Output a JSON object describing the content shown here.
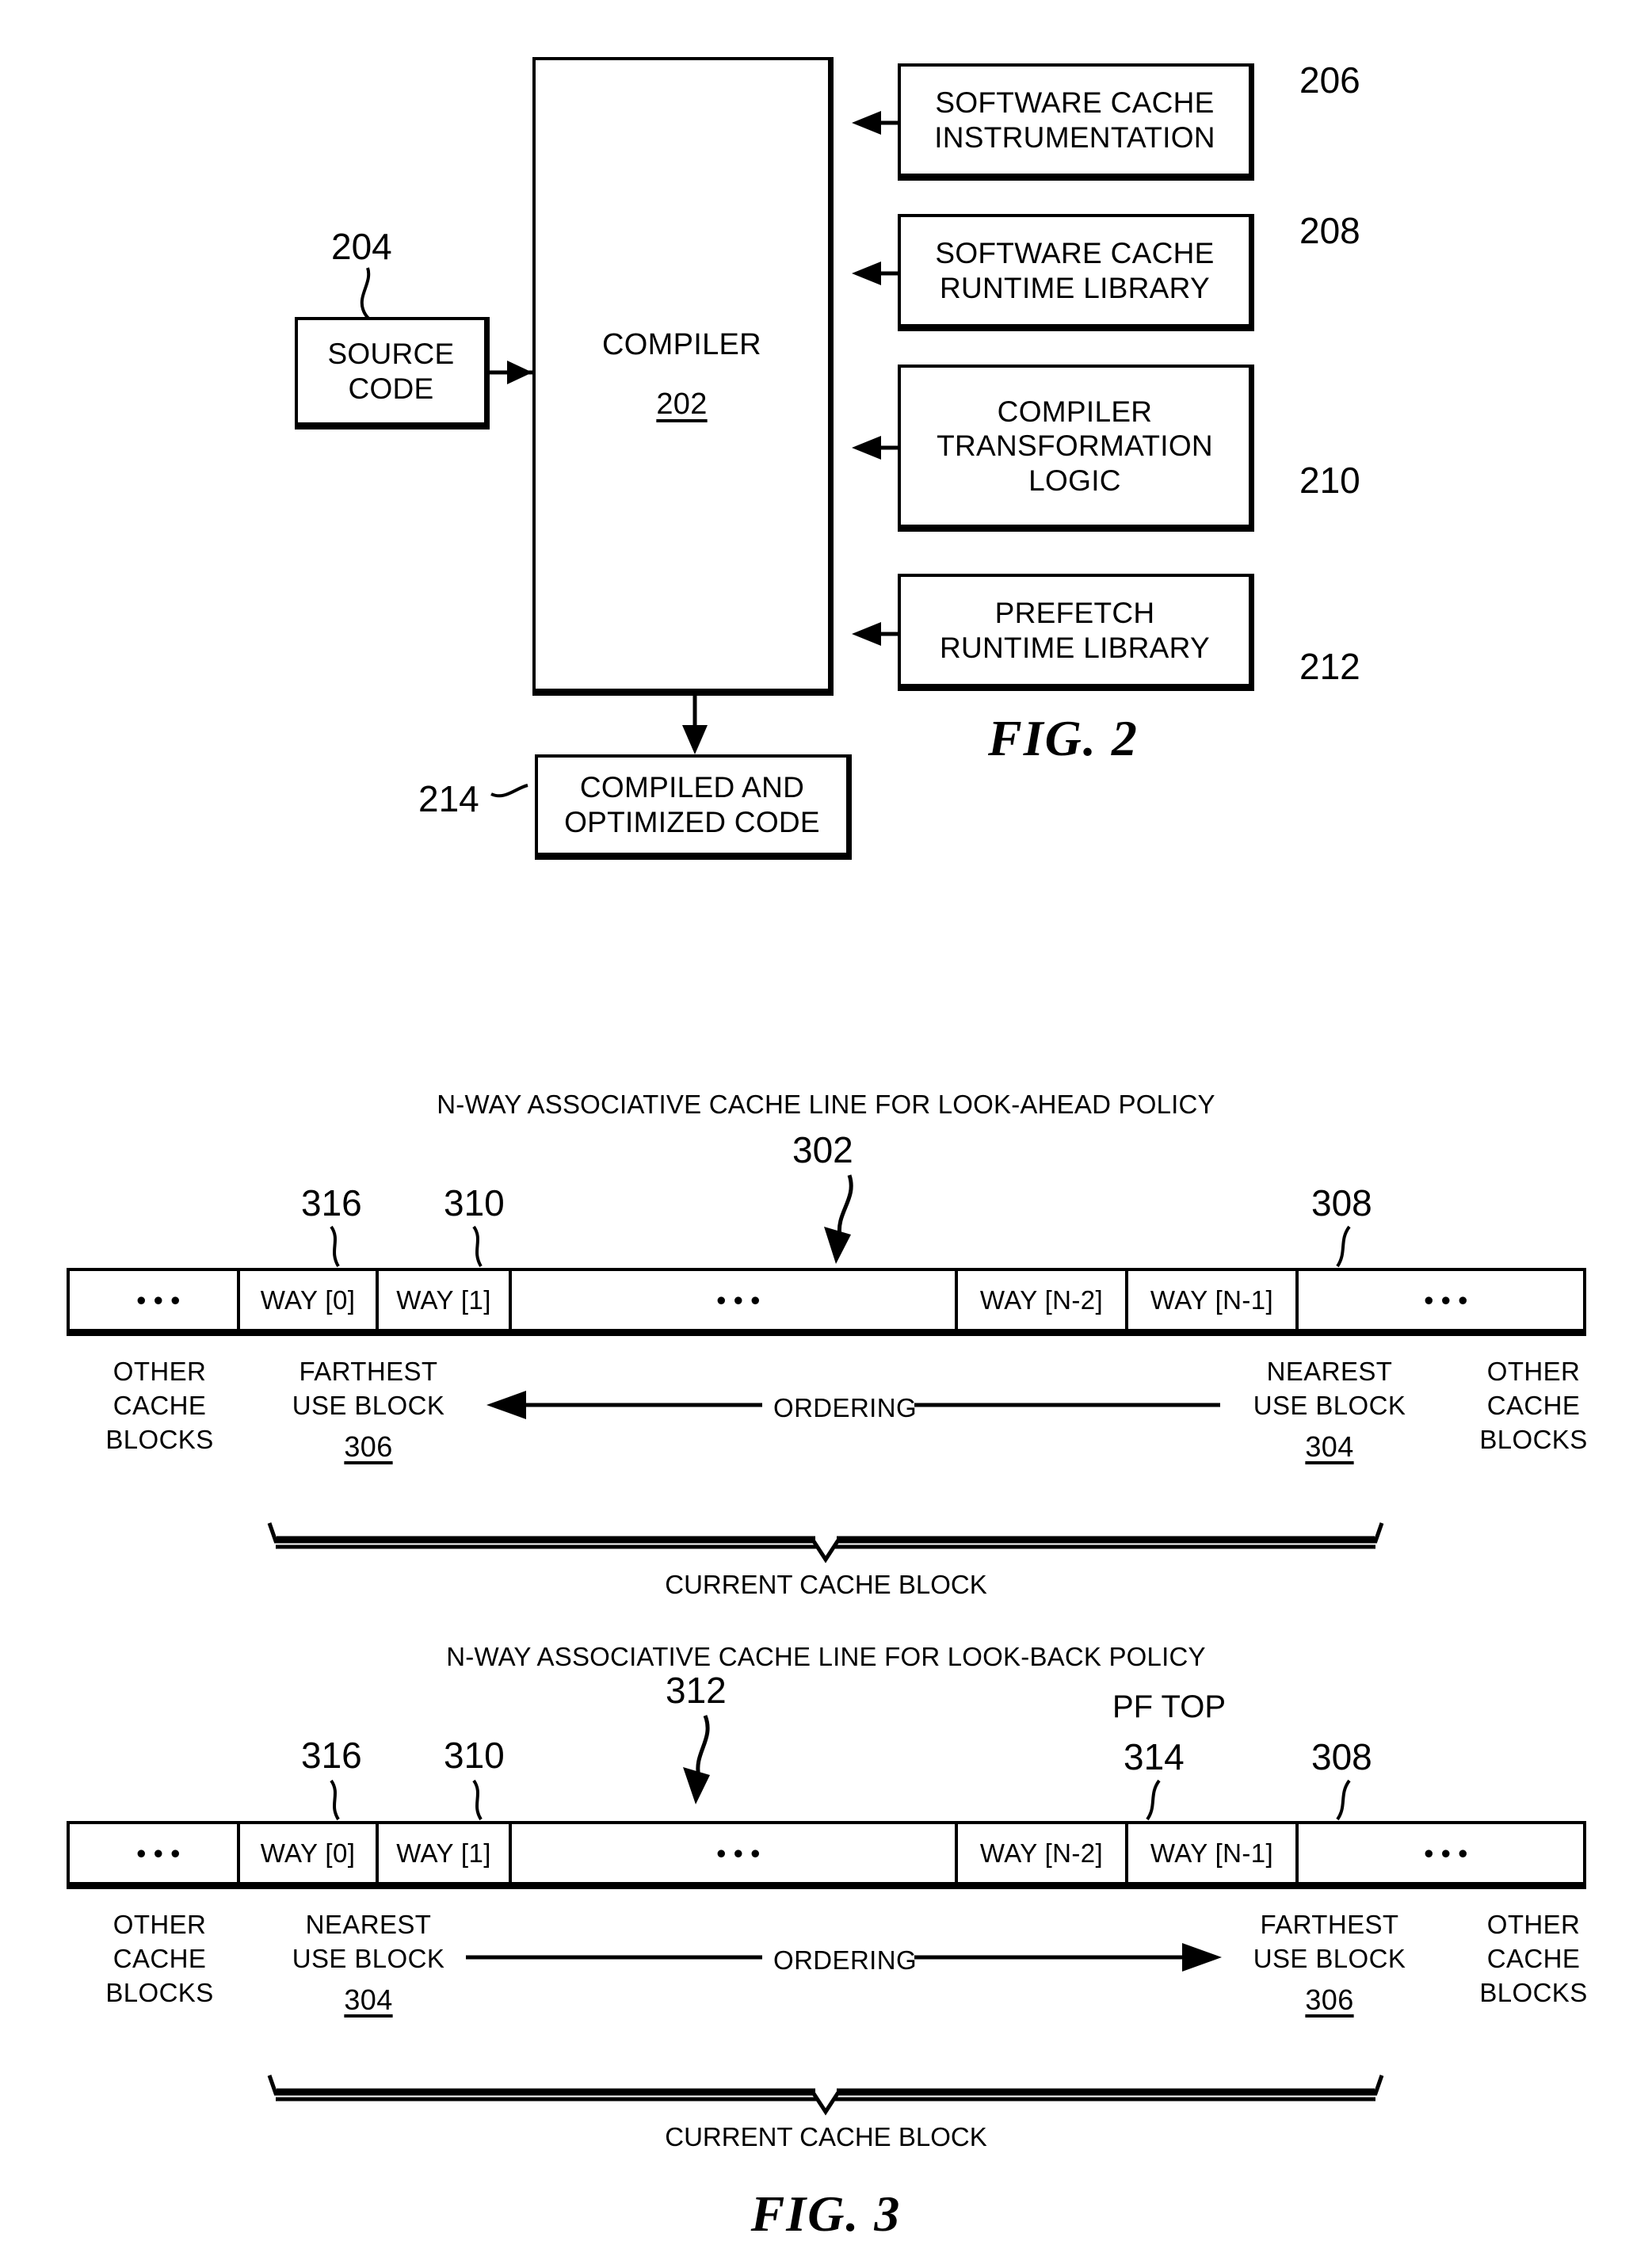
{
  "figure2": {
    "label": "FIG. 2",
    "compiler": {
      "title": "COMPILER",
      "ref": "202"
    },
    "source_code": {
      "line1": "SOURCE",
      "line2": "CODE",
      "ref": "204"
    },
    "inputs": [
      {
        "line1": "SOFTWARE CACHE",
        "line2": "INSTRUMENTATION",
        "line3": "",
        "ref": "206"
      },
      {
        "line1": "SOFTWARE CACHE",
        "line2": "RUNTIME LIBRARY",
        "line3": "",
        "ref": "208"
      },
      {
        "line1": "COMPILER",
        "line2": "TRANSFORMATION",
        "line3": "LOGIC",
        "ref": "210"
      },
      {
        "line1": "PREFETCH",
        "line2": "RUNTIME LIBRARY",
        "line3": "",
        "ref": "212"
      }
    ],
    "output": {
      "line1": "COMPILED AND",
      "line2": "OPTIMIZED CODE",
      "ref": "214"
    }
  },
  "figure3": {
    "label": "FIG. 3",
    "diagrams": [
      {
        "title": "N-WAY ASSOCIATIVE CACHE LINE FOR LOOK-AHEAD POLICY",
        "line_ref": "302",
        "cells": [
          {
            "text": "• • •",
            "kind": "dots"
          },
          {
            "text": "WAY [0]",
            "kind": "way"
          },
          {
            "text": "WAY [1]",
            "kind": "way"
          },
          {
            "text": "• • •",
            "kind": "dots"
          },
          {
            "text": "WAY [N-2]",
            "kind": "way"
          },
          {
            "text": "WAY [N-1]",
            "kind": "way"
          },
          {
            "text": "• • •",
            "kind": "dots"
          }
        ],
        "way0_ref": "316",
        "way1_ref": "310",
        "wayn1_ref": "308",
        "pf_top_label": "",
        "pf_top_ref": "",
        "left_outer": {
          "line1": "OTHER",
          "line2": "CACHE",
          "line3": "BLOCKS"
        },
        "right_outer": {
          "line1": "OTHER",
          "line2": "CACHE",
          "line3": "BLOCKS"
        },
        "left_block": {
          "line1": "FARTHEST",
          "line2": "USE BLOCK",
          "ref": "306"
        },
        "right_block": {
          "line1": "NEAREST",
          "line2": "USE BLOCK",
          "ref": "304"
        },
        "ordering_label": "ORDERING",
        "ordering_direction": "left",
        "brace_label": "CURRENT CACHE BLOCK"
      },
      {
        "title": "N-WAY ASSOCIATIVE CACHE LINE FOR LOOK-BACK POLICY",
        "line_ref": "312",
        "cells": [
          {
            "text": "• • •",
            "kind": "dots"
          },
          {
            "text": "WAY [0]",
            "kind": "way"
          },
          {
            "text": "WAY [1]",
            "kind": "way"
          },
          {
            "text": "• • •",
            "kind": "dots"
          },
          {
            "text": "WAY [N-2]",
            "kind": "way"
          },
          {
            "text": "WAY [N-1]",
            "kind": "way"
          },
          {
            "text": "• • •",
            "kind": "dots"
          }
        ],
        "way0_ref": "316",
        "way1_ref": "310",
        "wayn1_ref": "308",
        "pf_top_label": "PF TOP",
        "pf_top_ref": "314",
        "left_outer": {
          "line1": "OTHER",
          "line2": "CACHE",
          "line3": "BLOCKS"
        },
        "right_outer": {
          "line1": "OTHER",
          "line2": "CACHE",
          "line3": "BLOCKS"
        },
        "left_block": {
          "line1": "NEAREST",
          "line2": "USE BLOCK",
          "ref": "304"
        },
        "right_block": {
          "line1": "FARTHEST",
          "line2": "USE BLOCK",
          "ref": "306"
        },
        "ordering_label": "ORDERING",
        "ordering_direction": "right",
        "brace_label": "CURRENT CACHE BLOCK"
      }
    ]
  }
}
